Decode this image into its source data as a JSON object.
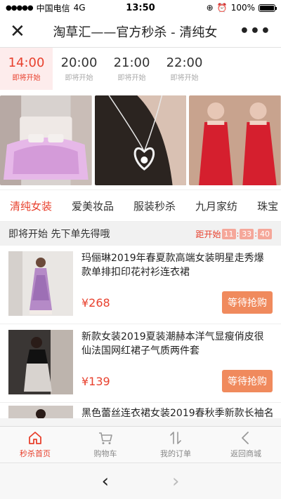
{
  "status": {
    "carrier": "中国电信",
    "network": "4G",
    "time": "13:50",
    "battery": "100%"
  },
  "navbar": {
    "title": "淘草汇——官方秒杀 - 清纯女"
  },
  "time_slots": [
    {
      "time": "14:00",
      "status": "即将开始",
      "active": true
    },
    {
      "time": "20:00",
      "status": "即将开始",
      "active": false
    },
    {
      "time": "21:00",
      "status": "即将开始",
      "active": false
    },
    {
      "time": "22:00",
      "status": "即将开始",
      "active": false
    }
  ],
  "categories": [
    "清纯女装",
    "爱美妆品",
    "服装秒杀",
    "九月家纺",
    "珠宝"
  ],
  "notice": {
    "message": "即将开始 先下单先得哦",
    "countdown_label": "距开始",
    "hours": "11",
    "minutes": "33",
    "seconds": "40"
  },
  "products": [
    {
      "name": "玛俪琳2019年春夏款高端女装明星走秀爆款单排扣印花衬衫连衣裙",
      "price": "¥268",
      "button": "等待抢购"
    },
    {
      "name": "新款女装2019夏装潮赫本洋气显瘦俏皮很仙法国网红裙子气质两件套",
      "price": "¥139",
      "button": "等待抢购"
    }
  ],
  "partial_product": {
    "name": "黑色蕾丝连衣裙女装2019春秋季新款长袖名"
  },
  "tabbar": [
    {
      "label": "秒杀首页",
      "icon": "home-icon",
      "active": true
    },
    {
      "label": "购物车",
      "icon": "cart-icon",
      "active": false
    },
    {
      "label": "我的订单",
      "icon": "orders-icon",
      "active": false
    },
    {
      "label": "返回商城",
      "icon": "back-icon",
      "active": false
    }
  ],
  "colors": {
    "accent": "#e8412e",
    "button": "#f08a5d"
  }
}
